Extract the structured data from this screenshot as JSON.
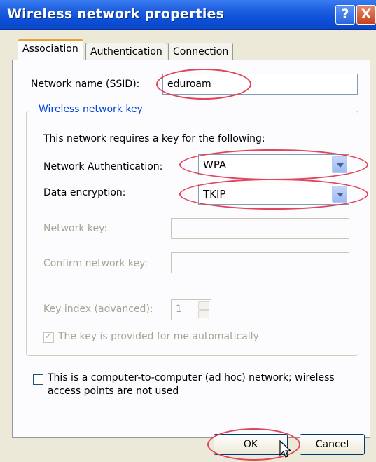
{
  "window": {
    "title": "Wireless network properties",
    "help_label": "?",
    "close_label": "X"
  },
  "tabs": [
    {
      "label": "Association",
      "active": true
    },
    {
      "label": "Authentication",
      "active": false
    },
    {
      "label": "Connection",
      "active": false
    }
  ],
  "association": {
    "ssid_label": "Network name (SSID):",
    "ssid_value": "eduroam",
    "group_legend": "Wireless network key",
    "requires_text": "This network requires a key for the following:",
    "auth_label": "Network Authentication:",
    "auth_value": "WPA",
    "encryption_label": "Data encryption:",
    "encryption_value": "TKIP",
    "network_key_label": "Network key:",
    "confirm_key_label": "Confirm network key:",
    "key_index_label": "Key index (advanced):",
    "key_index_value": "1",
    "auto_key_label": "The key is provided for me automatically",
    "auto_key_checked": true,
    "adhoc_label_line1": "This is a computer-to-computer (ad hoc) network; wireless",
    "adhoc_label_line2": "access points are not used",
    "adhoc_checked": false
  },
  "buttons": {
    "ok_label": "OK",
    "cancel_label": "Cancel"
  },
  "annotation_color": "#e0455a",
  "titlebar_color": "#0a4fd8"
}
